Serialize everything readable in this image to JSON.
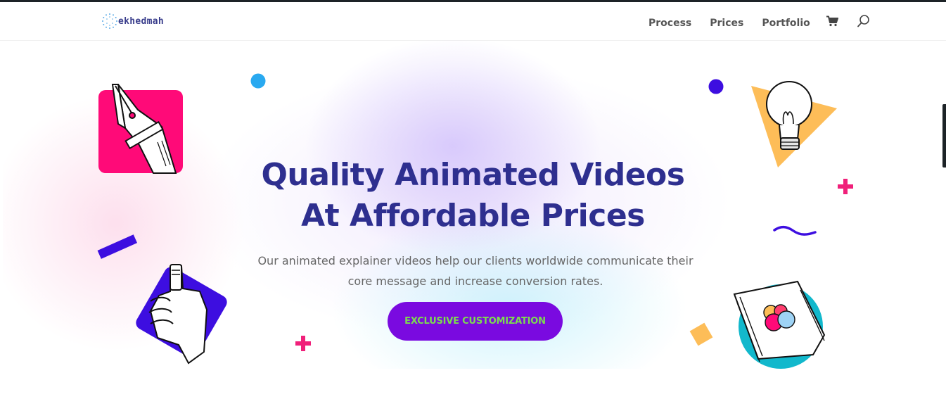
{
  "header": {
    "logo_text": "ekhedmah",
    "nav": [
      {
        "label": "Process"
      },
      {
        "label": "Prices"
      },
      {
        "label": "Portfolio"
      }
    ],
    "cart_icon": "cart-icon",
    "search_icon": "search-icon"
  },
  "hero": {
    "title_line1": "Quality Animated Videos",
    "title_line2": "At Affordable Prices",
    "subtitle_line1": "Our animated explainer videos help our clients worldwide communicate their",
    "subtitle_line2": "core message and increase conversion rates.",
    "cta_label": "EXCLUSIVE CUSTOMIZATION"
  },
  "colors": {
    "title": "#2e2f8f",
    "cta_bg": "#7a0ae0",
    "cta_text": "#7ddc4e",
    "pink": "#ff0a78",
    "purple": "#3d0ee0",
    "yellow": "#fdbd58",
    "cyan": "#12b8cc",
    "blue_dot": "#29a9f0"
  },
  "illustrations": [
    "pen-nib-illustration",
    "thumbs-up-illustration",
    "lightbulb-illustration",
    "color-palette-illustration"
  ]
}
